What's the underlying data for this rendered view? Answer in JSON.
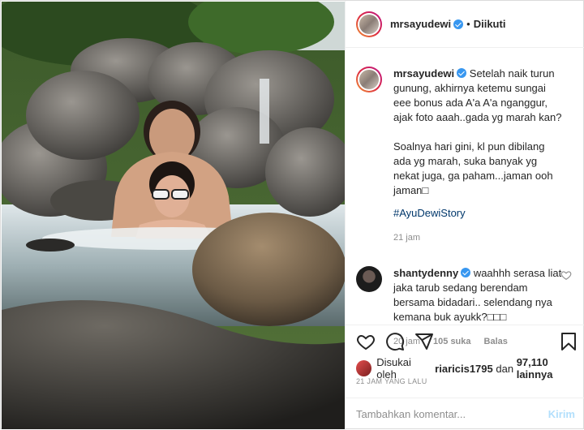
{
  "post": {
    "author": "mrsayudewi",
    "follow_state": "Diikuti",
    "separator": "•"
  },
  "caption": {
    "author": "mrsayudewi",
    "text": "Setelah naik turun gunung, akhirnya ketemu sungai eee bonus ada A'a A'a nganggur, ajak foto aaah..gada yg marah kan?\n\nSoalnya hari gini, kl pun dibilang ada yg marah, suka banyak yg nekat juga, ga paham...jaman ooh jaman□",
    "hashtag": "#AyuDewiStory",
    "time": "21 jam"
  },
  "comment": {
    "author": "shantydenny",
    "text": "waahhh serasa liat jaka tarub sedang berendam bersama bidadari.. selendang nya kemana buk ayukk?□□□",
    "time": "20 jam",
    "likes": "105 suka",
    "reply": "Balas"
  },
  "actions": {
    "icons": [
      "heart-icon",
      "comment-icon",
      "share-icon",
      "bookmark-icon"
    ]
  },
  "likes": {
    "prefix": "Disukai oleh",
    "user": "riaricis1795",
    "middle": "dan",
    "count": "97,110 lainnya"
  },
  "timestamp": "21 JAM YANG LALU",
  "add_comment": {
    "placeholder": "Tambahkan komentar...",
    "post_label": "Kirim"
  },
  "colors": {
    "verified": "#3897f0",
    "hashtag": "#00376b",
    "muted": "#8e8e8e",
    "post_button_disabled": "#b2dffc"
  }
}
